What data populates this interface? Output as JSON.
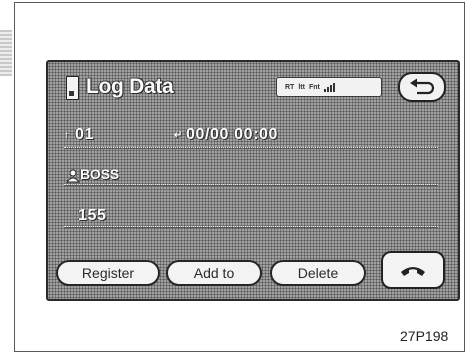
{
  "screen": {
    "title": "Log Data",
    "status_icons": [
      "signal-icon",
      "battery-icon",
      "antenna-icon"
    ],
    "status_text": [
      "RT",
      "ltt",
      "Fnt"
    ],
    "entry": {
      "number_prefix": "↑",
      "number": "01",
      "date_prefix": "↵",
      "datetime": "00/00 00:00",
      "name": "BOSS",
      "phone_number": "155"
    },
    "buttons": {
      "register": "Register",
      "add_to": "Add to",
      "delete": "Delete"
    }
  },
  "caption": "27P198",
  "colors": {
    "screen_halftone": "#909090",
    "button_fill": "#f3f3f3",
    "outline": "#222222"
  }
}
